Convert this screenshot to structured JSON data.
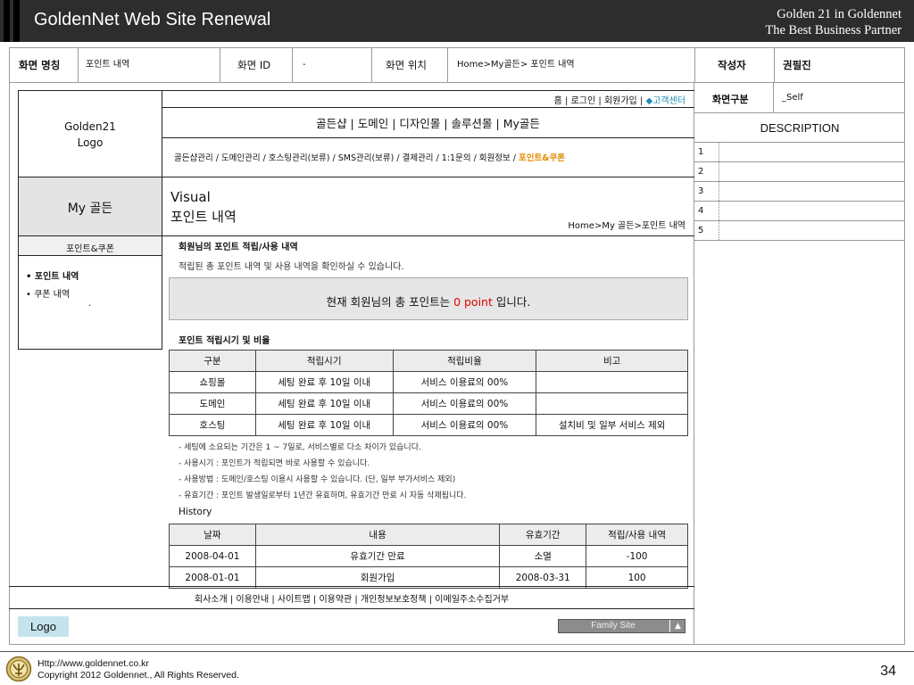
{
  "header": {
    "title": "GoldenNet Web Site Renewal",
    "subtitle_line1": "Golden 21 in Goldennet",
    "subtitle_line2": "The Best Business Partner"
  },
  "info": {
    "screen_name_label": "화면 명칭",
    "screen_name_value": "포인트 내역",
    "screen_id_label": "화면 ID",
    "screen_id_value": "-",
    "screen_location_label": "화면 위치",
    "screen_location_value": "Home>My골든> 포인트 내역",
    "author_label": "작성자",
    "author_value": "권필진",
    "screen_type_label": "화면구분",
    "screen_type_value": "_Self",
    "description_label": "DESCRIPTION",
    "description_rows": [
      "1",
      "2",
      "3",
      "4",
      "5"
    ]
  },
  "mockup": {
    "logo_line1": "Golden21",
    "logo_line2": "Logo",
    "util_links": [
      "홈",
      "로그인",
      "회원가입"
    ],
    "util_customer": "◆고객센터",
    "util_sep": "|",
    "gnb": "골든샵 | 도메인 | 디자인몰 | 솔루션몰 | My골든",
    "lnb_text": "골든샵관리 / 도메인관리 / 호스팅관리(보류) / SMS관리(보류) / 결제관리 / 1:1문의 / 회원정보 / ",
    "lnb_active": "포인트&쿠폰",
    "section_title": "My 골든",
    "visual_line1": "Visual",
    "visual_line2": "포인트 내역",
    "visual_breadcrumb": "Home>My 골든>포인트 내역",
    "side_menu_title": "포인트&쿠폰",
    "side_menu_items": [
      "• 포인트 내역",
      "• 쿠폰 내역"
    ],
    "side_menu_dot": ".",
    "point_heading": "회원님의 포인트 적립/사용 내역",
    "point_desc": "적립된 총 포인트 내역 및 사용 내역을 확인하실 수 있습니다.",
    "total_prefix": "현재 회원님의 총 포인트는 ",
    "total_value": "0 point",
    "total_suffix": " 입니다.",
    "rate_heading": "포인트 적립시기 및 비율",
    "rate_table": {
      "headers": [
        "구분",
        "적립시기",
        "적립비율",
        "비고"
      ],
      "rows": [
        [
          "쇼핑몰",
          "세팅 완료 후 10일 이내",
          "서비스 이용료의 00%",
          ""
        ],
        [
          "도메인",
          "세팅 완료 후 10일 이내",
          "서비스 이용료의 00%",
          ""
        ],
        [
          "호스팅",
          "세팅 완료 후 10일 이내",
          "서비스 이용료의 00%",
          "설치비 및 일부 서비스 제외"
        ]
      ]
    },
    "notes": [
      "- 세팅에 소요되는 기간은 1 ~ 7일로, 서비스별로 다소 차이가 있습니다.",
      "- 사용시기 : 포인트가 적립되면 바로 사용할 수 있습니다.",
      "- 사용방법 : 도메인/호스팅 이용시 사용할 수 있습니다. (단, 일부 부가서비스 제외)",
      "- 유효기간 : 포인트 발생일로부터 1년간 유효하며, 유효기간 만료 시 자동 삭제됩니다."
    ],
    "history_heading": "History",
    "history_table": {
      "headers": [
        "날짜",
        "내용",
        "유효기간",
        "적립/사용 내역"
      ],
      "rows": [
        [
          "2008-04-01",
          "유효기간 만료",
          "소멸",
          "-100"
        ],
        [
          "2008-01-01",
          "회원가입",
          "2008-03-31",
          "100"
        ]
      ]
    },
    "footer_links": "회사소개 | 이용안내 | 사이트맵 | 이용약관 | 개인정보보호정책 | 이메일주소수집거부",
    "footer_logo": "Logo",
    "family_site": "Family Site",
    "family_site_arrow": "▲"
  },
  "page_footer": {
    "url": "Http://www.goldennet.co.kr",
    "copyright": "Copyright 2012 Goldennet., All Rights Reserved.",
    "page_number": "34"
  },
  "colors": {
    "header_bg": "#2d2d2d",
    "accent_orange": "#e38b00",
    "point_red": "#e00000",
    "customer_center": "#1a8fb0",
    "logo_box": "#c5e3ec",
    "family_site_bg": "#8c8c8c"
  },
  "icons": {
    "brand_emblem": "golden-emblem-icon",
    "family_arrow": "triangle-up-icon"
  }
}
